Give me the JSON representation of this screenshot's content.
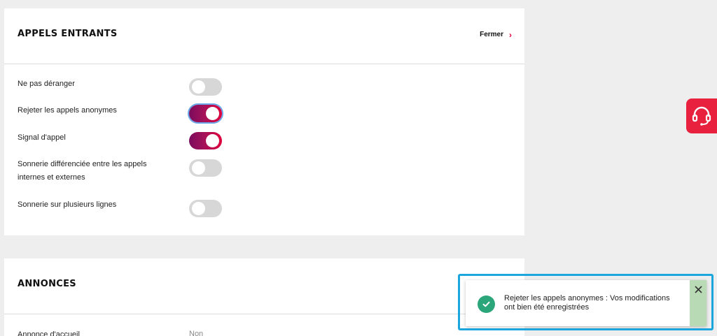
{
  "section_incoming": {
    "title": "APPELS ENTRANTS",
    "close_label": "Fermer",
    "settings": [
      {
        "label": "Ne pas déranger",
        "on": false
      },
      {
        "label": "Rejeter les appels anonymes",
        "on": true
      },
      {
        "label": "Signal d'appel",
        "on": true
      },
      {
        "label": "Sonnerie différenciée entre les appels internes et externes",
        "on": false
      },
      {
        "label": "Sonnerie sur plusieurs lignes",
        "on": false
      }
    ]
  },
  "section_announcements": {
    "title": "ANNONCES",
    "welcome_label": "Annonce d'accueil",
    "welcome_value": "Non"
  },
  "toast": {
    "message": "Rejeter les appels anonymes : Vos modifications ont bien été enregistrées"
  },
  "colors": {
    "accent": "#e0003c",
    "toggle_on_start": "#7c0b5c",
    "toggle_off": "#d7d7d7",
    "success": "#2aa67a",
    "focus_frame": "#1ba7de"
  },
  "icons": {
    "support": "headset-icon",
    "close_link": "chevron-right-icon",
    "toast_status": "check-circle-icon",
    "toast_close": "close-icon"
  }
}
